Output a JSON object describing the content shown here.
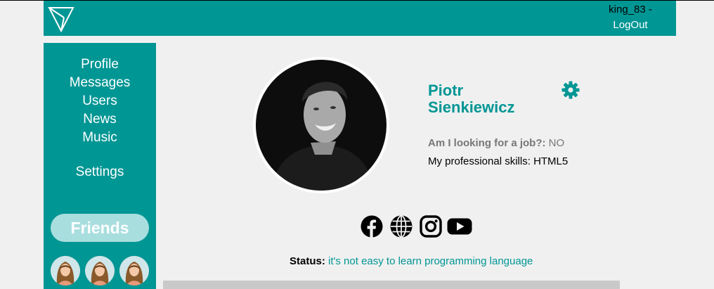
{
  "header": {
    "logo_icon": "triangle-logo-icon",
    "username": "king_83 -",
    "logout_label": "LogOut",
    "background": "#009694"
  },
  "sidebar": {
    "items": [
      {
        "label": "Profile"
      },
      {
        "label": "Messages"
      },
      {
        "label": "Users"
      },
      {
        "label": "News"
      },
      {
        "label": "Music"
      },
      {
        "label": "Settings"
      }
    ],
    "friends_label": "Friends",
    "friends_count_shown": 3,
    "friend_avatar_icon": "female-avatar-icon"
  },
  "profile": {
    "name_line1": "Piotr",
    "name_line2": "Sienkiewicz",
    "settings_icon": "gear-icon",
    "job_label": "Am I looking for a job?:",
    "job_value": "NO",
    "skills_label": "My professional skills:",
    "skills_value": "HTML5",
    "social_icons": [
      "facebook-icon",
      "globe-icon",
      "instagram-icon",
      "youtube-icon"
    ],
    "status_label": "Status:",
    "status_text": "it's not easy to learn programming language"
  },
  "colors": {
    "accent": "#009694",
    "friends_button": "#a9dedf",
    "page_background": "#f0f0f0"
  }
}
